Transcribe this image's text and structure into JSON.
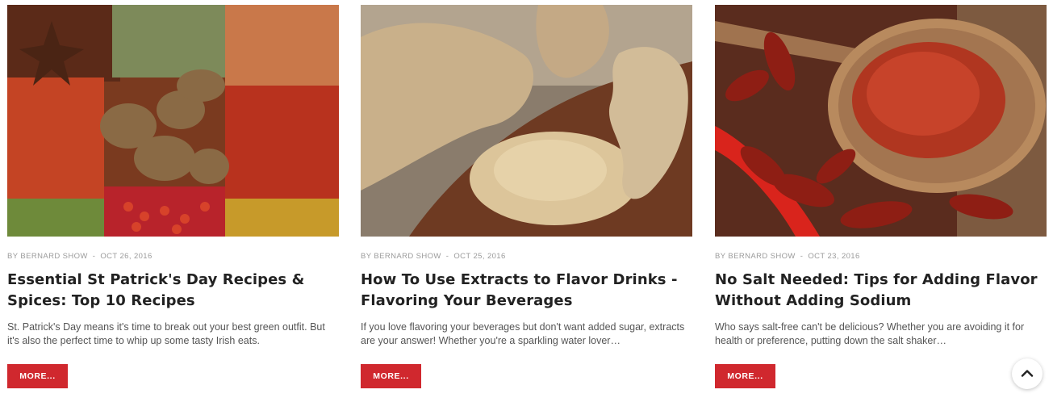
{
  "posts": [
    {
      "image": "spices-assortment",
      "author": "BY BERNARD SHOW",
      "separator": "-",
      "date": "OCT 26, 2016",
      "title": "Essential St Patrick's Day Recipes & Spices: Top 10 Recipes",
      "excerpt": "St. Patrick's Day means it's time to break out your best green outfit. But it's also the perfect time to whip up some tasty Irish eats.",
      "button": "MORE..."
    },
    {
      "image": "ginger-powder",
      "author": "BY BERNARD SHOW",
      "separator": "-",
      "date": "OCT 25, 2016",
      "title": "How To Use Extracts to Flavor Drinks - Flavoring Your Beverages",
      "excerpt": "If you love flavoring your beverages but don't want added sugar, extracts are your answer! Whether you're a sparkling water lover…",
      "button": "MORE..."
    },
    {
      "image": "chili-peppers-spoon",
      "author": "BY BERNARD SHOW",
      "separator": "-",
      "date": "OCT 23, 2016",
      "title": "No Salt Needed: Tips for Adding Flavor Without Adding Sodium",
      "excerpt": "Who says salt-free can't be delicious? Whether you are avoiding it for health or preference, putting down the salt shaker…",
      "button": "MORE..."
    }
  ],
  "scroll_top": {
    "icon": "chevron-up-icon"
  },
  "colors": {
    "accent": "#d0282e",
    "meta": "#9b9b9b",
    "title": "#222222"
  }
}
